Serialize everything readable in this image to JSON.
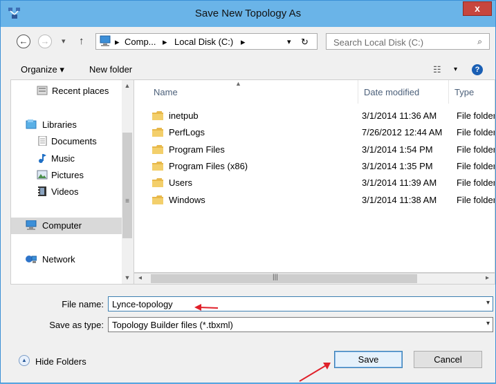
{
  "window": {
    "title": "Save New Topology As",
    "close_label": "x"
  },
  "toolbar": {
    "back_glyph": "←",
    "forward_glyph": "→",
    "history_glyph": "▾",
    "up_glyph": "↑",
    "address_crumbs": [
      "Comp...",
      "Local Disk (C:)"
    ],
    "address_separator": "▸",
    "address_dropdown_glyph": "▾",
    "refresh_glyph": "↻",
    "search_placeholder": "Search Local Disk (C:)",
    "search_icon_glyph": "⌕"
  },
  "commandbar": {
    "organize_label": "Organize ▾",
    "new_folder_label": "New folder",
    "view_glyph": "☷",
    "view_dropdown_glyph": "▾",
    "help_glyph": "?"
  },
  "navigation": {
    "items": [
      {
        "label": "Recent places",
        "icon": "recent-places-icon"
      },
      {
        "label": "Libraries",
        "icon": "libraries-icon"
      },
      {
        "label": "Documents",
        "icon": "documents-icon"
      },
      {
        "label": "Music",
        "icon": "music-icon"
      },
      {
        "label": "Pictures",
        "icon": "pictures-icon"
      },
      {
        "label": "Videos",
        "icon": "videos-icon"
      },
      {
        "label": "Computer",
        "icon": "computer-icon",
        "selected": true
      },
      {
        "label": "Network",
        "icon": "network-icon"
      }
    ]
  },
  "file_list": {
    "columns": [
      "Name",
      "Date modified",
      "Type"
    ],
    "rows": [
      {
        "name": "inetpub",
        "date": "3/1/2014 11:36 AM",
        "type": "File folder"
      },
      {
        "name": "PerfLogs",
        "date": "7/26/2012 12:44 AM",
        "type": "File folder"
      },
      {
        "name": "Program Files",
        "date": "3/1/2014 1:54 PM",
        "type": "File folder"
      },
      {
        "name": "Program Files (x86)",
        "date": "3/1/2014 1:35 PM",
        "type": "File folder"
      },
      {
        "name": "Users",
        "date": "3/1/2014 11:39 AM",
        "type": "File folder"
      },
      {
        "name": "Windows",
        "date": "3/1/2014 11:38 AM",
        "type": "File folder"
      }
    ]
  },
  "form": {
    "file_name_label": "File name:",
    "file_name_value": "Lynce-topology",
    "save_type_label": "Save as type:",
    "save_type_value": "Topology Builder files (*.tbxml)",
    "dropdown_glyph": "▾"
  },
  "footer": {
    "hide_folders_label": "Hide Folders",
    "save_label": "Save",
    "cancel_label": "Cancel"
  },
  "colors": {
    "title_bar": "#6ab4e8",
    "close_button": "#c7463e",
    "annotation_arrow": "#e0202a",
    "folder": "#e8b84a"
  }
}
